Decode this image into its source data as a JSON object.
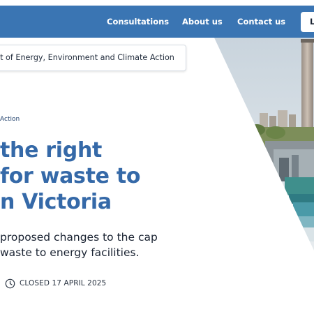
{
  "nav": {
    "items": [
      "Consultations",
      "About us",
      "Contact us"
    ],
    "login_label": "L"
  },
  "department": {
    "label": "nt of Energy, Environment and Climate Action"
  },
  "breadcrumb": {
    "current": "Action"
  },
  "hero": {
    "title_lines": [
      "the right",
      "for waste to",
      "n Victoria"
    ],
    "summary_lines": [
      "proposed changes to the cap",
      "waste to energy facilities."
    ]
  },
  "status": {
    "icon": "clock-icon",
    "text": "CLOSED 17 APRIL 2025"
  },
  "colors": {
    "brand_blue": "#3a75b3",
    "title_blue": "#3569a8"
  }
}
